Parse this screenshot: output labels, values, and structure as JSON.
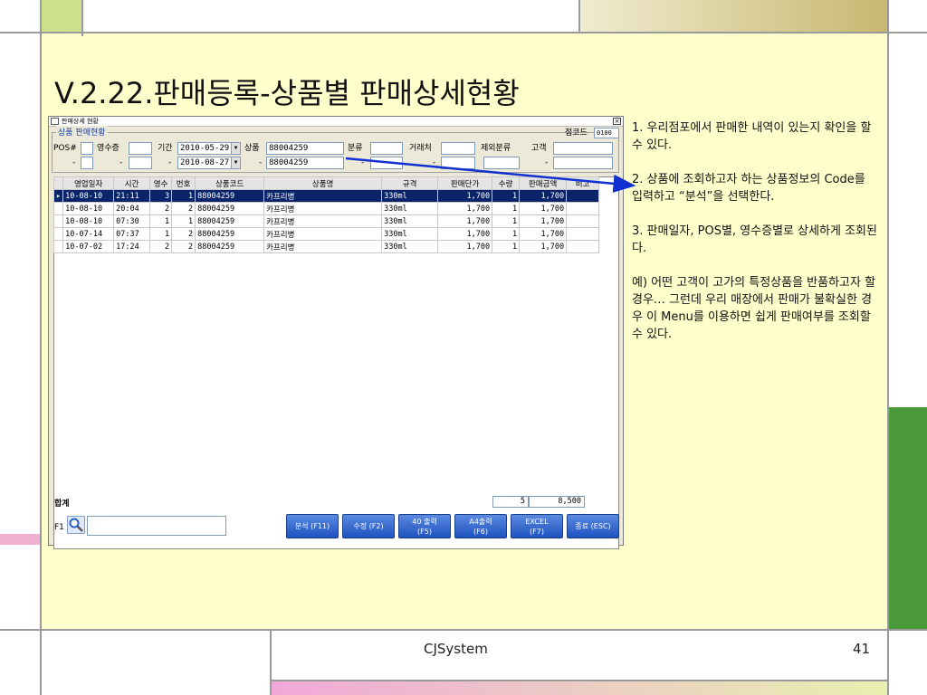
{
  "slide": {
    "title": "V.2.22.판매등록-상품별 판매상세현황",
    "footer_center": "CJSystem",
    "footer_page": "41",
    "notes": [
      "1. 우리점포에서 판매한 내역이 있는지 확인을 할 수 있다.",
      "2. 상품에 조회하고자 하는 상품정보의 Code를 입력하고 “분석”을 선택한다.",
      "3. 판매일자, POS별, 영수증별로 상세하게 조회된다.",
      "예) 어떤 고객이 고가의 특정상품을 반품하고자 할 경우… 그런데 우리 매장에서 판매가 불확실한 경우 이 Menu를 이용하면 쉽게 판매여부를 조회할 수 있다."
    ],
    "colors": {
      "accent_yellow": "#ffffcc",
      "selection": "#0a246a",
      "arrow": "#1030d0",
      "button": "#2a5fd0"
    }
  },
  "window": {
    "title": "판매상세 현황",
    "close_label": "×",
    "group_label": "상품 판매현황",
    "store_code_label": "점코드",
    "store_code_value": "0100",
    "filters": {
      "pos_label": "POS#",
      "receipt_label": "영수증",
      "period_label": "기간",
      "period_from": "2010-05-29",
      "period_to": "2010-08-27",
      "product_label": "상품",
      "product_from": "88004259",
      "product_to": "88004259",
      "category_label": "분류",
      "vendor_label": "거래처",
      "exclude_label": "제외분류",
      "customer_label": "고객",
      "dash": "-"
    },
    "grid": {
      "columns": [
        "영업일자",
        "시간",
        "영수",
        "번호",
        "상품코드",
        "상품명",
        "규격",
        "판매단가",
        "수량",
        "판매금액",
        "비고"
      ],
      "rows": [
        [
          "10-08-10",
          "21:11",
          "3",
          "1",
          "88004259",
          "카프리병",
          "330ml",
          "1,700",
          "1",
          "1,700",
          ""
        ],
        [
          "10-08-10",
          "20:04",
          "2",
          "2",
          "88004259",
          "카프리병",
          "330ml",
          "1,700",
          "1",
          "1,700",
          ""
        ],
        [
          "10-08-10",
          "07:30",
          "1",
          "1",
          "88004259",
          "카프리병",
          "330ml",
          "1,700",
          "1",
          "1,700",
          ""
        ],
        [
          "10-07-14",
          "07:37",
          "1",
          "2",
          "88004259",
          "카프리병",
          "330ml",
          "1,700",
          "1",
          "1,700",
          ""
        ],
        [
          "10-07-02",
          "17:24",
          "2",
          "2",
          "88004259",
          "카프리병",
          "330ml",
          "1,700",
          "1",
          "1,700",
          ""
        ]
      ]
    },
    "summary": {
      "label": "합계",
      "qty": "5",
      "amount": "8,500"
    },
    "f1_label": "F1",
    "buttons": [
      {
        "label": "분석 (F11)"
      },
      {
        "label": "수정 (F2)"
      },
      {
        "label": "40 출력\n(F5)"
      },
      {
        "label": "A4출력\n(F6)"
      },
      {
        "label": "EXCEL\n(F7)"
      },
      {
        "label": "종료 (ESC)"
      }
    ]
  }
}
